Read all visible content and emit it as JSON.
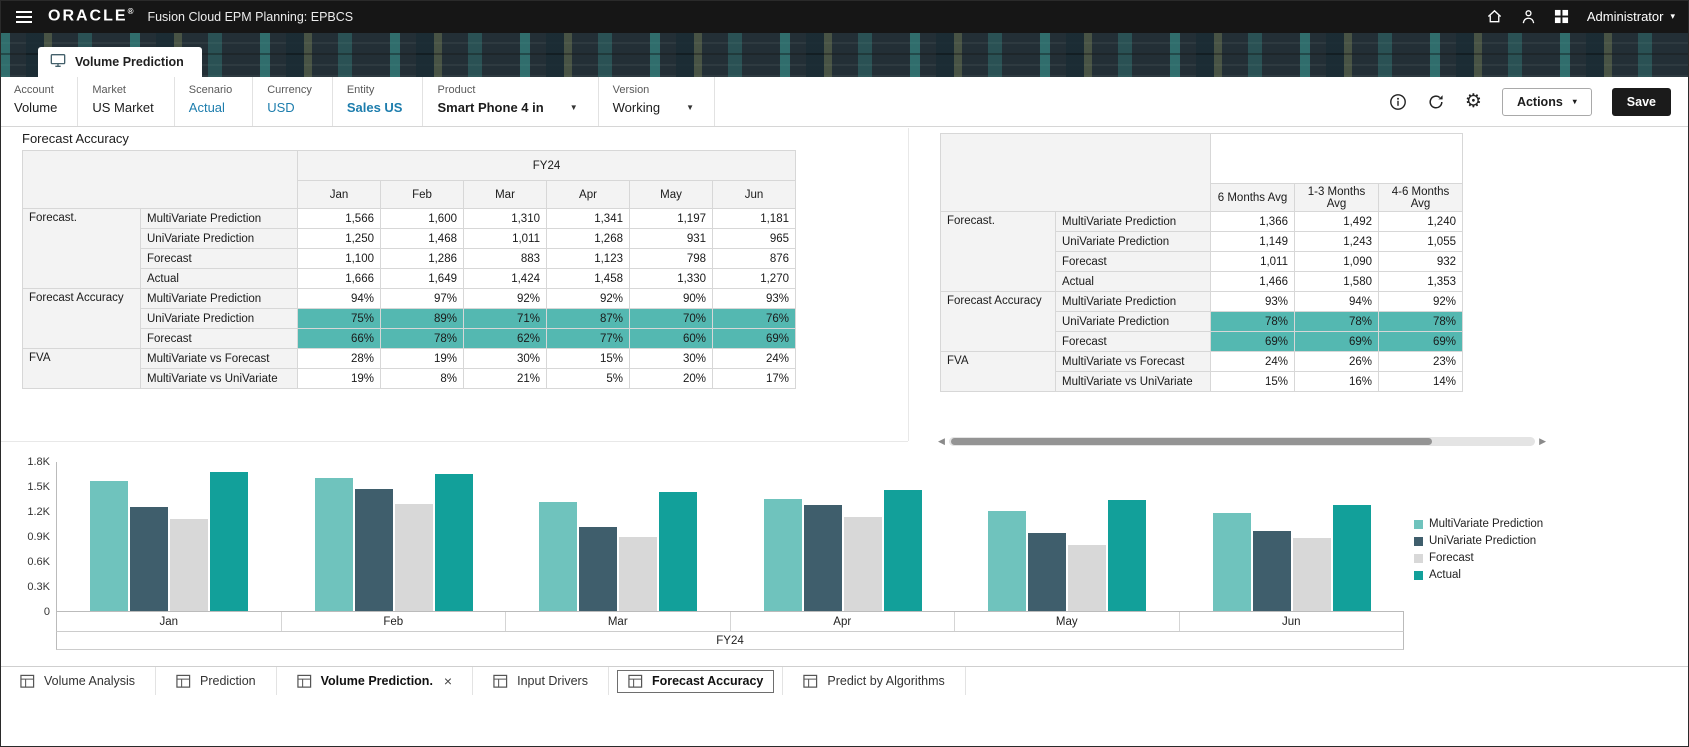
{
  "colors": {
    "highlight": "#54b8b1",
    "link": "#1d7dad",
    "topbar_bg": "#161616",
    "save_bg": "#1b1b1b"
  },
  "icons": {
    "hamburger": "☰",
    "caret_down": "▾",
    "caret_small": "▼",
    "gear": "⚙",
    "close": "×",
    "scroll_left": "◀",
    "scroll_right": "▶",
    "registered": "®"
  },
  "topbar": {
    "brand": "ORACLE",
    "app_title": "Fusion Cloud EPM Planning: EPBCS",
    "user": "Administrator"
  },
  "page_tab": {
    "label": "Volume Prediction"
  },
  "pov": {
    "items": [
      {
        "dim": "Account",
        "member": "Volume",
        "style": "plain"
      },
      {
        "dim": "Market",
        "member": "US Market",
        "style": "plain"
      },
      {
        "dim": "Scenario",
        "member": "Actual",
        "style": "link"
      },
      {
        "dim": "Currency",
        "member": "USD",
        "style": "link"
      },
      {
        "dim": "Entity",
        "member": "Sales US",
        "style": "link-bold"
      },
      {
        "dim": "Product",
        "member": "Smart Phone 4 in",
        "style": "bold",
        "dropdown": true
      },
      {
        "dim": "Version",
        "member": "Working",
        "style": "plain",
        "dropdown": true
      }
    ],
    "actions_label": "Actions",
    "save_label": "Save"
  },
  "section_title": "Forecast Accuracy",
  "left_table": {
    "year_header": "FY24",
    "columns": [
      "Jan",
      "Feb",
      "Mar",
      "Apr",
      "May",
      "Jun"
    ],
    "rows": [
      {
        "group": "Forecast.",
        "group_span": 4,
        "member": "MultiVariate Prediction",
        "values": [
          "1,566",
          "1,600",
          "1,310",
          "1,341",
          "1,197",
          "1,181"
        ]
      },
      {
        "member": "UniVariate Prediction",
        "values": [
          "1,250",
          "1,468",
          "1,011",
          "1,268",
          "931",
          "965"
        ]
      },
      {
        "member": "Forecast",
        "values": [
          "1,100",
          "1,286",
          "883",
          "1,123",
          "798",
          "876"
        ]
      },
      {
        "member": "Actual",
        "values": [
          "1,666",
          "1,649",
          "1,424",
          "1,458",
          "1,330",
          "1,270"
        ]
      },
      {
        "group": "Forecast Accuracy",
        "group_span": 3,
        "member": "MultiVariate Prediction",
        "values": [
          "94%",
          "97%",
          "92%",
          "92%",
          "90%",
          "93%"
        ]
      },
      {
        "member": "UniVariate Prediction",
        "highlight": true,
        "values": [
          "75%",
          "89%",
          "71%",
          "87%",
          "70%",
          "76%"
        ]
      },
      {
        "member": "Forecast",
        "highlight": true,
        "values": [
          "66%",
          "78%",
          "62%",
          "77%",
          "60%",
          "69%"
        ]
      },
      {
        "group": "FVA",
        "group_span": 2,
        "member": "MultiVariate vs Forecast",
        "values": [
          "28%",
          "19%",
          "30%",
          "15%",
          "30%",
          "24%"
        ]
      },
      {
        "member": "MultiVariate vs UniVariate",
        "values": [
          "19%",
          "8%",
          "21%",
          "5%",
          "20%",
          "17%"
        ]
      }
    ]
  },
  "right_table": {
    "year_header": "",
    "columns": [
      "6 Months Avg",
      "1-3 Months Avg",
      "4-6 Months Avg"
    ],
    "rows": [
      {
        "group": "Forecast.",
        "group_span": 4,
        "member": "MultiVariate Prediction",
        "values": [
          "1,366",
          "1,492",
          "1,240"
        ]
      },
      {
        "member": "UniVariate Prediction",
        "values": [
          "1,149",
          "1,243",
          "1,055"
        ]
      },
      {
        "member": "Forecast",
        "values": [
          "1,011",
          "1,090",
          "932"
        ]
      },
      {
        "member": "Actual",
        "values": [
          "1,466",
          "1,580",
          "1,353"
        ]
      },
      {
        "group": "Forecast Accuracy",
        "group_span": 3,
        "member": "MultiVariate Prediction",
        "values": [
          "93%",
          "94%",
          "92%"
        ]
      },
      {
        "member": "UniVariate Prediction",
        "highlight": true,
        "values": [
          "78%",
          "78%",
          "78%"
        ]
      },
      {
        "member": "Forecast",
        "highlight": true,
        "values": [
          "69%",
          "69%",
          "69%"
        ]
      },
      {
        "group": "FVA",
        "group_span": 2,
        "member": "MultiVariate vs Forecast",
        "values": [
          "24%",
          "26%",
          "23%"
        ]
      },
      {
        "member": "MultiVariate vs UniVariate",
        "values": [
          "15%",
          "16%",
          "14%"
        ]
      }
    ]
  },
  "chart_data": {
    "type": "bar",
    "title": "",
    "categories": [
      "Jan",
      "Feb",
      "Mar",
      "Apr",
      "May",
      "Jun"
    ],
    "series": [
      {
        "name": "MultiVariate Prediction",
        "color": "#6fc3bd",
        "values": [
          1566,
          1600,
          1310,
          1341,
          1197,
          1181
        ]
      },
      {
        "name": "UniVariate Prediction",
        "color": "#3f5e6c",
        "values": [
          1250,
          1468,
          1011,
          1268,
          931,
          965
        ]
      },
      {
        "name": "Forecast",
        "color": "#d8d8d8",
        "values": [
          1100,
          1286,
          883,
          1123,
          798,
          876
        ]
      },
      {
        "name": "Actual",
        "color": "#12a09a",
        "values": [
          1666,
          1649,
          1424,
          1458,
          1330,
          1270
        ]
      }
    ],
    "xlabel": "FY24",
    "ylabel": "",
    "ylim": [
      0,
      1800
    ],
    "y_ticks": [
      "1.8K",
      "1.5K",
      "1.2K",
      "0.9K",
      "0.6K",
      "0.3K",
      "0"
    ],
    "grid": false,
    "legend_position": "right"
  },
  "bottom_tabs": [
    {
      "label": "Volume Analysis"
    },
    {
      "label": "Prediction"
    },
    {
      "label": "Volume Prediction.",
      "active": true,
      "closable": true
    },
    {
      "label": "Input Drivers"
    },
    {
      "label": "Forecast Accuracy",
      "selected": true
    },
    {
      "label": "Predict by Algorithms"
    }
  ]
}
